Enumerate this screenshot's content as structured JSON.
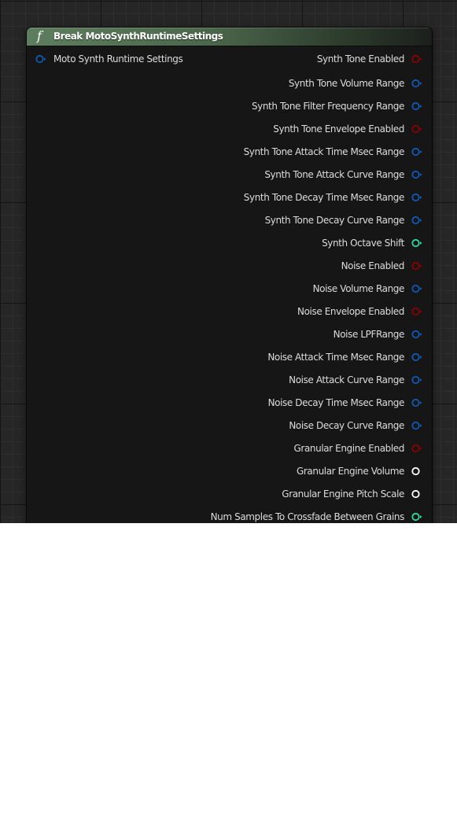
{
  "node": {
    "title": "Break MotoSynthRuntimeSettings",
    "icon": "function-icon",
    "input_pin": {
      "label": "Moto Synth Runtime Settings",
      "type": "struct",
      "color": "#0f5ab4"
    },
    "output_pins": [
      {
        "label": "Synth Tone Enabled",
        "type": "boolean",
        "color": "#8c0000"
      },
      {
        "label": "Synth Tone Volume Range",
        "type": "struct",
        "color": "#0f5ab4"
      },
      {
        "label": "Synth Tone Filter Frequency Range",
        "type": "struct",
        "color": "#0f5ab4"
      },
      {
        "label": "Synth Tone Envelope Enabled",
        "type": "boolean",
        "color": "#8c0000"
      },
      {
        "label": "Synth Tone Attack Time Msec Range",
        "type": "struct",
        "color": "#0f5ab4"
      },
      {
        "label": "Synth Tone Attack Curve Range",
        "type": "struct",
        "color": "#0f5ab4"
      },
      {
        "label": "Synth Tone Decay Time Msec Range",
        "type": "struct",
        "color": "#0f5ab4"
      },
      {
        "label": "Synth Tone Decay Curve Range",
        "type": "struct",
        "color": "#0f5ab4"
      },
      {
        "label": "Synth Octave Shift",
        "type": "integer",
        "color": "#2edca0"
      },
      {
        "label": "Noise Enabled",
        "type": "boolean",
        "color": "#8c0000"
      },
      {
        "label": "Noise Volume Range",
        "type": "struct",
        "color": "#0f5ab4"
      },
      {
        "label": "Noise Envelope Enabled",
        "type": "boolean",
        "color": "#8c0000"
      },
      {
        "label": "Noise LPFRange",
        "type": "struct",
        "color": "#0f5ab4"
      },
      {
        "label": "Noise Attack Time Msec Range",
        "type": "struct",
        "color": "#0f5ab4"
      },
      {
        "label": "Noise Attack Curve Range",
        "type": "struct",
        "color": "#0f5ab4"
      },
      {
        "label": "Noise Decay Time Msec Range",
        "type": "struct",
        "color": "#0f5ab4"
      },
      {
        "label": "Noise Decay Curve Range",
        "type": "struct",
        "color": "#0f5ab4"
      },
      {
        "label": "Granular Engine Enabled",
        "type": "boolean",
        "color": "#8c0000"
      },
      {
        "label": "Granular Engine Volume",
        "type": "float",
        "color": "#ffffff"
      },
      {
        "label": "Granular Engine Pitch Scale",
        "type": "float",
        "color": "#ffffff"
      },
      {
        "label": "Num Samples To Crossfade Between Grains",
        "type": "integer",
        "color": "#2edca0"
      }
    ]
  }
}
